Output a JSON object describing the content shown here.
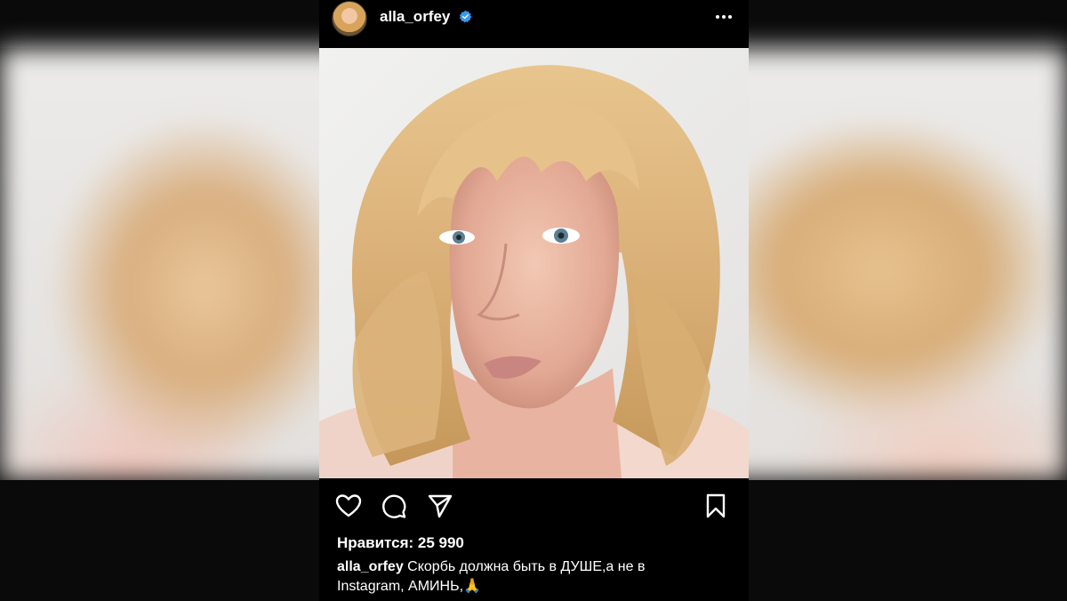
{
  "post": {
    "username": "alla_orfey",
    "verified": true,
    "likes_label": "Нравится: 25 990",
    "caption_user": "alla_orfey",
    "caption_text": "Скорбь должна быть в ДУШЕ,а не в Instagram,  АМИНЬ,🙏"
  },
  "icons": {
    "avatar": "avatar",
    "verified": "verified-badge-icon",
    "more": "more-options-icon",
    "like": "heart-icon",
    "comment": "comment-icon",
    "share": "share-icon",
    "save": "bookmark-icon"
  },
  "colors": {
    "background": "#000000",
    "text": "#ffffff",
    "verified_blue": "#3897f0"
  }
}
